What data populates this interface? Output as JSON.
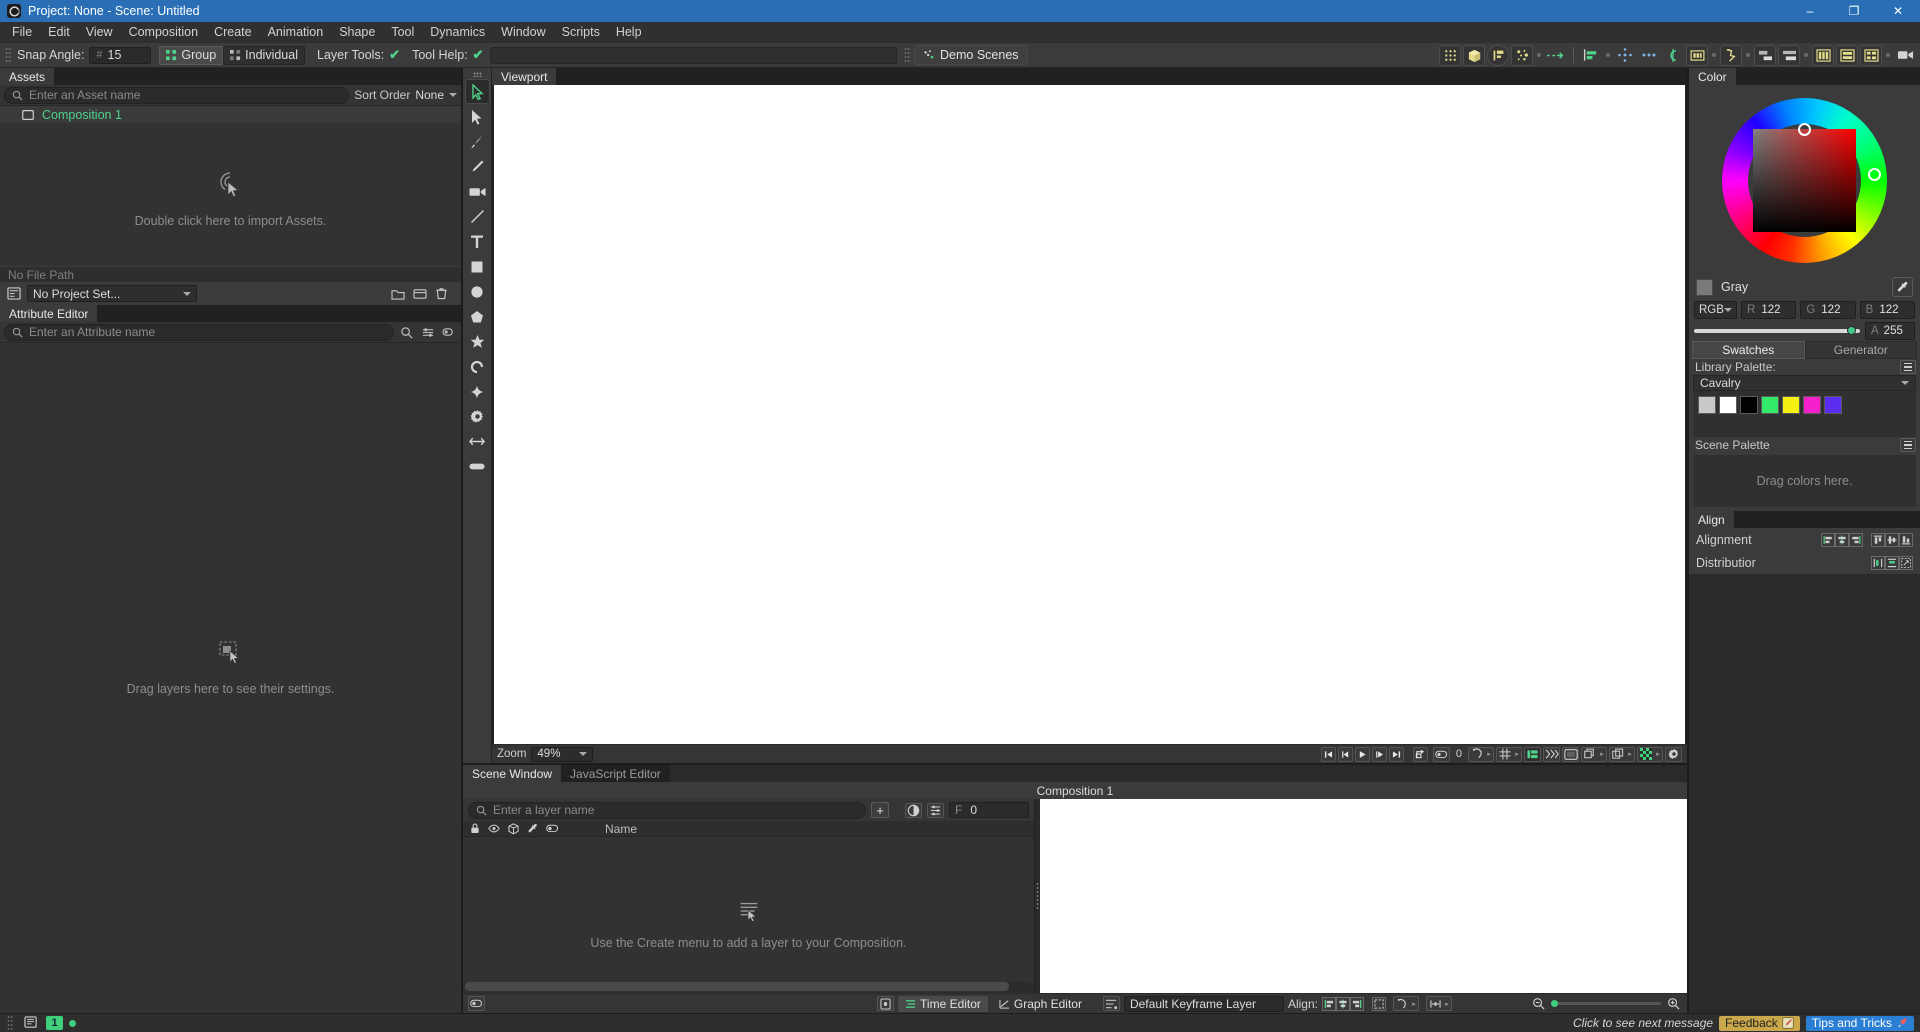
{
  "window": {
    "title": "Project: None - Scene: Untitled",
    "minimize": "–",
    "maximize": "❐",
    "close": "✕"
  },
  "menubar": {
    "items": [
      "File",
      "Edit",
      "View",
      "Composition",
      "Create",
      "Animation",
      "Shape",
      "Tool",
      "Dynamics",
      "Window",
      "Scripts",
      "Help"
    ]
  },
  "toolbar": {
    "snap_angle_label": "Snap Angle:",
    "snap_angle_hash": "#",
    "snap_angle_value": "15",
    "group_label": "Group",
    "individual_label": "Individual",
    "layer_tools_label": "Layer Tools:",
    "layer_tools_check": "✔",
    "tool_help_label": "Tool Help:",
    "tool_help_check": "✔",
    "demo_scenes_label": "Demo Scenes",
    "icons": [
      "dot-grid-icon",
      "cube-icon",
      "layout-frame-icon",
      "particles-icon",
      "motion-path-icon",
      "align-bar-icon",
      "move-arrows-icon",
      "three-dots-icon",
      "curve-icon",
      "filmstrip-icon",
      "trail-icon",
      "stagger-down-icon",
      "stagger-up-icon",
      "columns-icon",
      "rows-icon",
      "grid-layout-icon",
      "camera-icon"
    ]
  },
  "assets": {
    "tab": "Assets",
    "search_placeholder": "Enter an Asset name",
    "search_icon": "search-icon",
    "sort_order_label": "Sort Order",
    "sort_order_value": "None",
    "items": [
      {
        "name": "Composition 1",
        "icon": "composition-icon"
      }
    ],
    "empty_hint": "Double click here to import Assets.",
    "file_path": "No File Path",
    "project_value": "No Project Set...",
    "project_icon": "project-icon",
    "folder_icon": "folder-icon",
    "window-icon": "window-icon",
    "trash_icon": "trash-icon"
  },
  "attribute_editor": {
    "tab": "Attribute Editor",
    "search_placeholder": "Enter an Attribute name",
    "search_icon": "search-icon",
    "empty_hint": "Drag layers here to see their settings.",
    "icons": [
      "zoom-attr-icon",
      "filter-attr-icon",
      "clear-attr-icon"
    ]
  },
  "tools": [
    {
      "name": "select-tool",
      "glyph": "select",
      "active": true
    },
    {
      "name": "direct-select-tool",
      "glyph": "arrow"
    },
    {
      "name": "pen-tool",
      "glyph": "pen"
    },
    {
      "name": "pencil-tool",
      "glyph": "pencil"
    },
    {
      "name": "camera-tool",
      "glyph": "camera"
    },
    {
      "name": "line-tool",
      "glyph": "line"
    },
    {
      "name": "text-tool",
      "glyph": "T"
    },
    {
      "name": "rectangle-tool",
      "glyph": "rect"
    },
    {
      "name": "ellipse-tool",
      "glyph": "ellipse"
    },
    {
      "name": "polygon-tool",
      "glyph": "polygon"
    },
    {
      "name": "star-tool",
      "glyph": "star"
    },
    {
      "name": "arc-tool",
      "glyph": "arc"
    },
    {
      "name": "sparkle-tool",
      "glyph": "sparkle"
    },
    {
      "name": "gear-tool",
      "glyph": "gear"
    },
    {
      "name": "arrow-tool",
      "glyph": "doublearrow"
    },
    {
      "name": "rounded-rect-tool",
      "glyph": "pill"
    }
  ],
  "viewport": {
    "tab": "Viewport",
    "zoom_label": "Zoom",
    "zoom_value": "49%",
    "transport": [
      "go-to-start-icon",
      "step-back-icon",
      "play-icon",
      "step-forward-icon",
      "go-to-end-icon",
      "loop-icon"
    ],
    "counter_value": "0",
    "right_icons": [
      "tag-icon",
      "snap-icon",
      "grid-icon",
      "guides-icon",
      "fast-preview-icon",
      "safe-area-icon",
      "layers-icon",
      "duplicate-icon",
      "transparency-icon",
      "settings-icon"
    ]
  },
  "scene": {
    "tabs": [
      {
        "label": "Scene Window",
        "active": true
      },
      {
        "label": "JavaScript Editor",
        "active": false
      }
    ],
    "composition_title": "Composition 1",
    "layer_search_placeholder": "Enter a layer name",
    "add_layer_label": "+",
    "frame_label": "F",
    "frame_value": "0",
    "column_header_name": "Name",
    "column_icons": [
      "lock-icon",
      "visibility-icon",
      "render-icon",
      "eyedropper-icon",
      "tag-icon"
    ],
    "toolbar_icons": [
      "onion-skin-icon",
      "settings-list-icon"
    ],
    "empty_hint": "Use the Create menu to add a layer to your Composition.",
    "footer": {
      "left_icon": "tag-icon",
      "mode_icon": "key-mode-icon",
      "time_editor": "Time Editor",
      "graph_editor": "Graph Editor"
    },
    "keyframe_bar": {
      "icon": "keyframe-layer-icon",
      "layer_name": "Default Keyframe Layer",
      "align_label": "Align:",
      "align_icons": [
        "align-left-icon",
        "align-center-icon",
        "align-right-icon",
        "fit-icon",
        "ease-icon",
        "distribute-icon"
      ],
      "zoom_out_icon": "zoom-out-icon",
      "zoom_in_icon": "zoom-in-icon"
    }
  },
  "color": {
    "tab": "Color",
    "swatch_name": "Gray",
    "mode": "RGB",
    "channels": [
      {
        "label": "R",
        "value": "122"
      },
      {
        "label": "G",
        "value": "122"
      },
      {
        "label": "B",
        "value": "122"
      }
    ],
    "alpha_label": "A",
    "alpha_value": "255",
    "eyedropper_icon": "eyedropper-icon",
    "swatch_hex": "#7a7a7a"
  },
  "swatches": {
    "tabs": [
      {
        "label": "Swatches",
        "active": true
      },
      {
        "label": "Generator",
        "active": false
      }
    ],
    "library_palette_label": "Library Palette:",
    "library_value": "Cavalry",
    "colors": [
      "#c8c8c8",
      "#ffffff",
      "#000000",
      "#34e86a",
      "#f5f011",
      "#f520cb",
      "#5b2df0"
    ],
    "scene_palette_label": "Scene Palette",
    "scene_palette_hint": "Drag colors here.",
    "menu_icon": "hamburger-icon"
  },
  "align": {
    "tab": "Align",
    "alignment_label": "Alignment",
    "distribution_label": "Distributior",
    "alignment_icons": [
      "align-left-icon",
      "align-h-center-icon",
      "align-right-icon",
      "align-top-icon",
      "align-v-center-icon",
      "align-bottom-icon"
    ],
    "distribution_icons": [
      "distribute-h-icon",
      "distribute-v-icon",
      "distribute-free-icon"
    ]
  },
  "statusbar": {
    "log_icon": "log-icon",
    "count_badge": "1",
    "status_dot": "status-dot",
    "next_message": "Click to see next message",
    "feedback_label": "Feedback",
    "feedback_icon": "pencil-note-icon",
    "tips_label": "Tips and Tricks",
    "tips_icon": "rocket-icon"
  }
}
